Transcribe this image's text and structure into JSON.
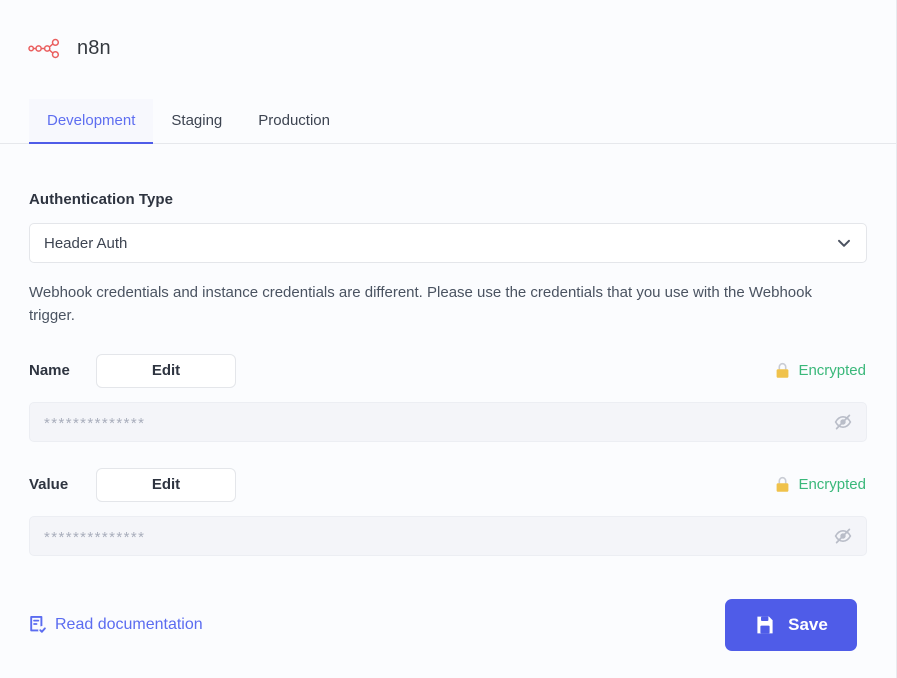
{
  "header": {
    "logo_icon": "n8n-node-graph-logo",
    "title": "n8n"
  },
  "tabs": [
    {
      "id": "development",
      "label": "Development",
      "active": true
    },
    {
      "id": "staging",
      "label": "Staging",
      "active": false
    },
    {
      "id": "production",
      "label": "Production",
      "active": false
    }
  ],
  "form": {
    "auth_type_label": "Authentication Type",
    "auth_type_value": "Header Auth",
    "caret_icon": "chevron-down-icon",
    "note": "Webhook credentials and instance credentials are different. Please use the credentials that you use with the Webhook trigger.",
    "credentials": [
      {
        "id": "name",
        "label": "Name",
        "edit_label": "Edit",
        "encrypted_label": "Encrypted",
        "lock_icon": "lock-icon",
        "masked_value": "**************",
        "reveal_icon": "eye-off-icon"
      },
      {
        "id": "value",
        "label": "Value",
        "edit_label": "Edit",
        "encrypted_label": "Encrypted",
        "lock_icon": "lock-icon",
        "masked_value": "**************",
        "reveal_icon": "eye-off-icon"
      }
    ]
  },
  "footer": {
    "doc_link_label": "Read documentation",
    "doc_icon": "document-check-icon",
    "save_label": "Save",
    "save_icon": "floppy-disk-save-icon"
  },
  "colors": {
    "accent_blue": "#4f5ce8",
    "tab_active_text": "#5e6ef0",
    "tab_active_bg": "#f7f8fd",
    "encrypted_green": "#3ab87a",
    "lock_gold": "#f0c24b",
    "page_bg": "#fbfcfe",
    "logo_red": "#ea5f5f",
    "masked_text": "#a9aebc"
  }
}
